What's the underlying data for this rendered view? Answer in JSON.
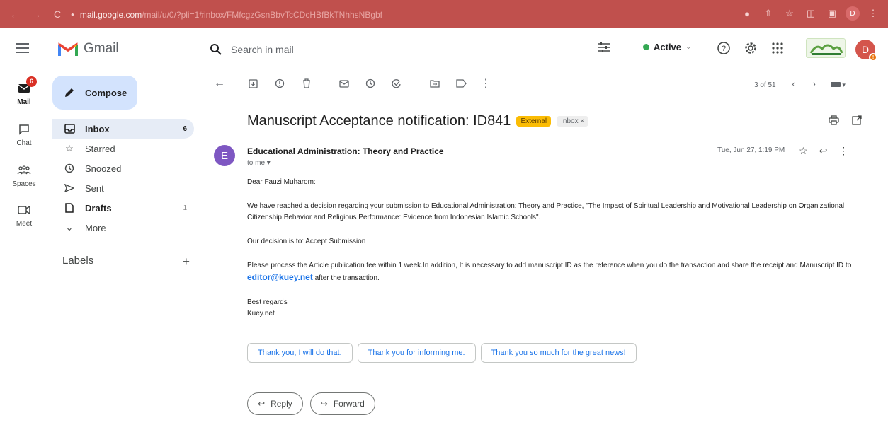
{
  "browser": {
    "url_host": "mail.google.com",
    "url_path": "/mail/u/0/?pli=1#inbox/FMfcgzGsnBbvTcCDcHBfBkTNhhsNBgbf",
    "profile_initial": "D"
  },
  "header": {
    "app_name": "Gmail",
    "search_placeholder": "Search in mail",
    "status_label": "Active",
    "avatar_initial": "D"
  },
  "rail": {
    "items": [
      {
        "label": "Mail",
        "badge": "6",
        "icon": "mail-icon"
      },
      {
        "label": "Chat",
        "icon": "chat-icon"
      },
      {
        "label": "Spaces",
        "icon": "spaces-icon"
      },
      {
        "label": "Meet",
        "icon": "meet-icon"
      }
    ]
  },
  "sidebar": {
    "compose_label": "Compose",
    "items": [
      {
        "label": "Inbox",
        "count": "6",
        "icon": "inbox-icon"
      },
      {
        "label": "Starred",
        "count": "",
        "icon": "star-icon"
      },
      {
        "label": "Snoozed",
        "count": "",
        "icon": "clock-icon"
      },
      {
        "label": "Sent",
        "count": "",
        "icon": "send-icon"
      },
      {
        "label": "Drafts",
        "count": "1",
        "icon": "draft-icon"
      },
      {
        "label": "More",
        "count": "",
        "icon": "chevron-down-icon"
      }
    ],
    "labels_heading": "Labels",
    "labels_add": "+"
  },
  "toolbar": {
    "pager_text": "3 of 51"
  },
  "email": {
    "subject": "Manuscript Acceptance notification: ID841",
    "chip_external": "External",
    "chip_inbox": "Inbox ×",
    "sender_initial": "E",
    "sender_name": "Educational Administration: Theory and Practice",
    "recipient": "to me ▾",
    "date": "Tue, Jun 27, 1:19 PM",
    "greeting": "Dear Fauzi Muharom:",
    "para1": "We have reached a decision regarding your submission to Educational Administration: Theory and Practice, \"The Impact of Spiritual Leadership and Motivational Leadership on Organizational Citizenship Behavior and Religious Performance: Evidence from Indonesian Islamic Schools\".",
    "decision": "Our decision is to: Accept Submission",
    "para3_start": "Please process the Article publication fee within 1 week.In addition, It is necessary to add manuscript ID as the reference when you do the transaction and  share the receipt and Manuscript ID to ",
    "para3_link": "editor@kuey.net",
    "para3_end": "  after the transaction.",
    "signoff": "Best regards",
    "signature": "Kuey.net"
  },
  "smart_replies": [
    "Thank you, I will do that.",
    "Thank you for informing me.",
    "Thank you so much for the great news!"
  ],
  "actions": {
    "reply_label": "Reply",
    "forward_label": "Forward"
  },
  "colors": {
    "browser_bar": "#c0504d",
    "compose_bg": "#d3e3fd",
    "selected_nav": "#e6ecf6",
    "external_chip": "#fbbc04",
    "link": "#1a73e8"
  }
}
